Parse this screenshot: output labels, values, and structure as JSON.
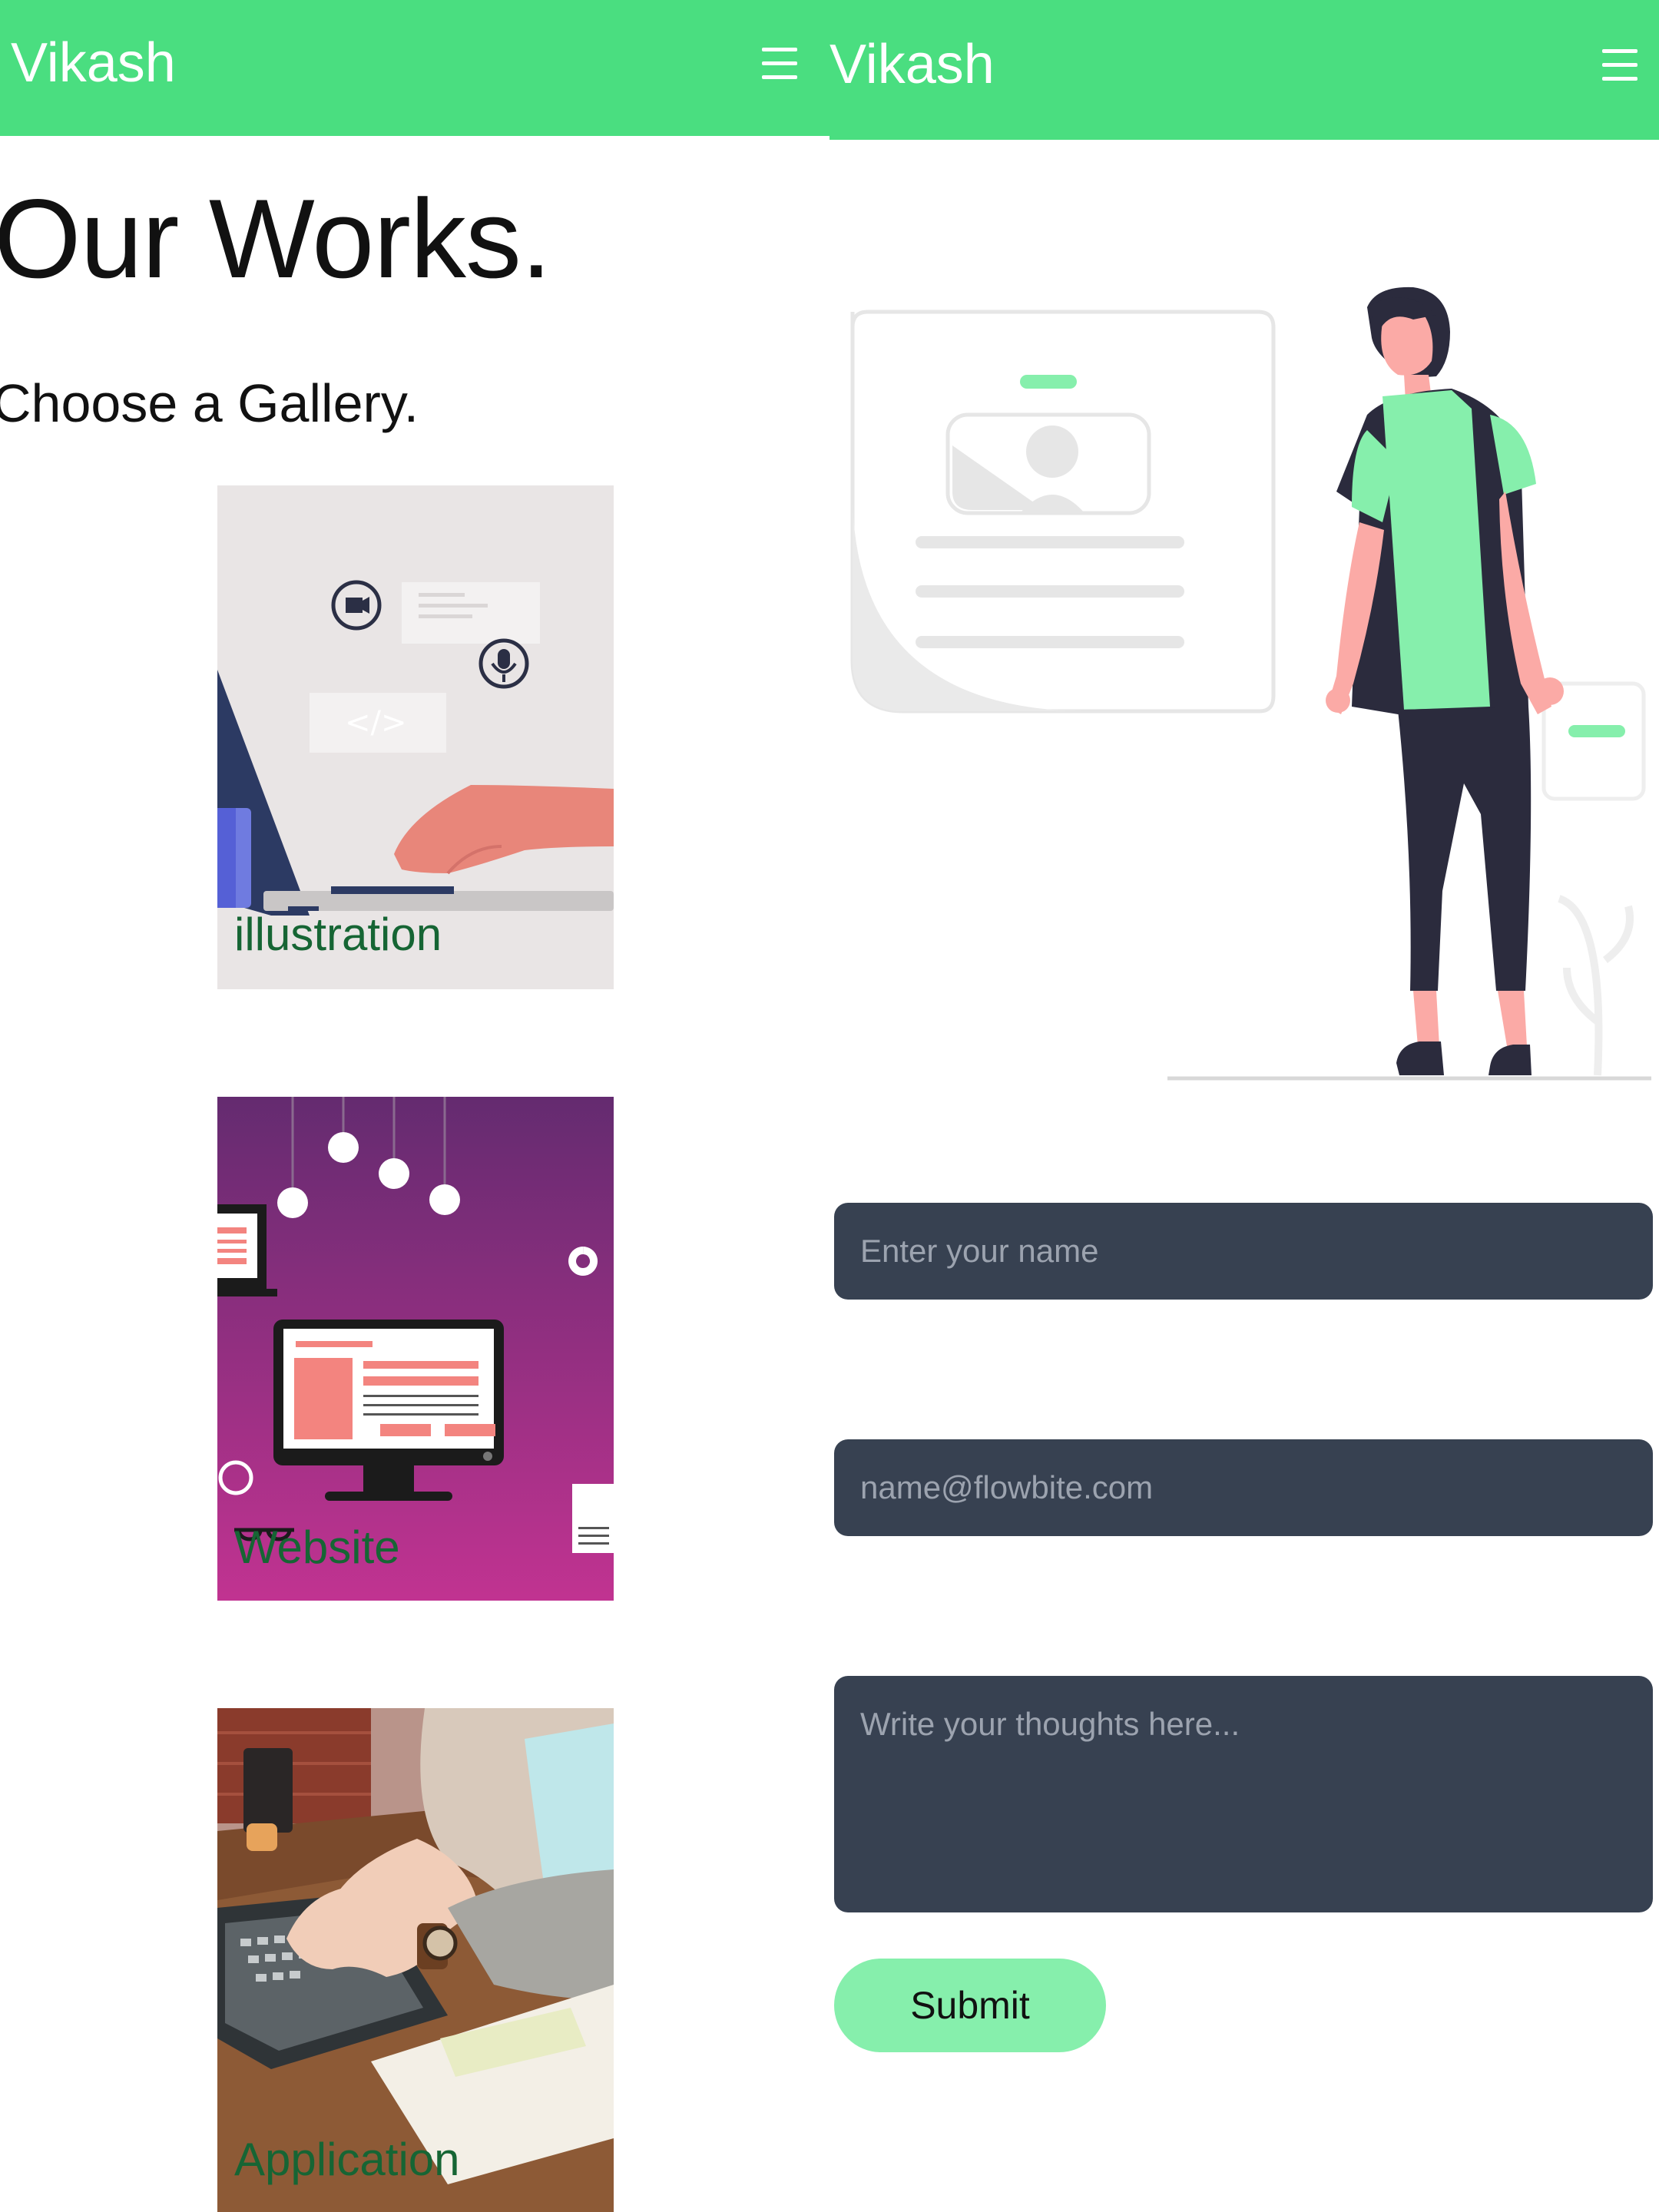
{
  "left_screen": {
    "navbar": {
      "brand": "Vikash",
      "menu_icon": "hamburger-menu-icon"
    },
    "title": "Our Works.",
    "subtitle": "Choose a Gallery.",
    "galleries": [
      {
        "label": "illustration"
      },
      {
        "label": "Website"
      },
      {
        "label": "Application"
      }
    ]
  },
  "right_screen": {
    "navbar": {
      "brand": "Vikash",
      "menu_icon": "hamburger-menu-icon"
    },
    "form": {
      "name_placeholder": "Enter your name",
      "email_placeholder": "name@flowbite.com",
      "message_placeholder": "Write your thoughts here...",
      "submit_label": "Submit"
    }
  },
  "colors": {
    "navbar": "#4ade80",
    "input_bg": "#374151",
    "submit_bg": "#86efac",
    "gallery_label": "#166534"
  }
}
